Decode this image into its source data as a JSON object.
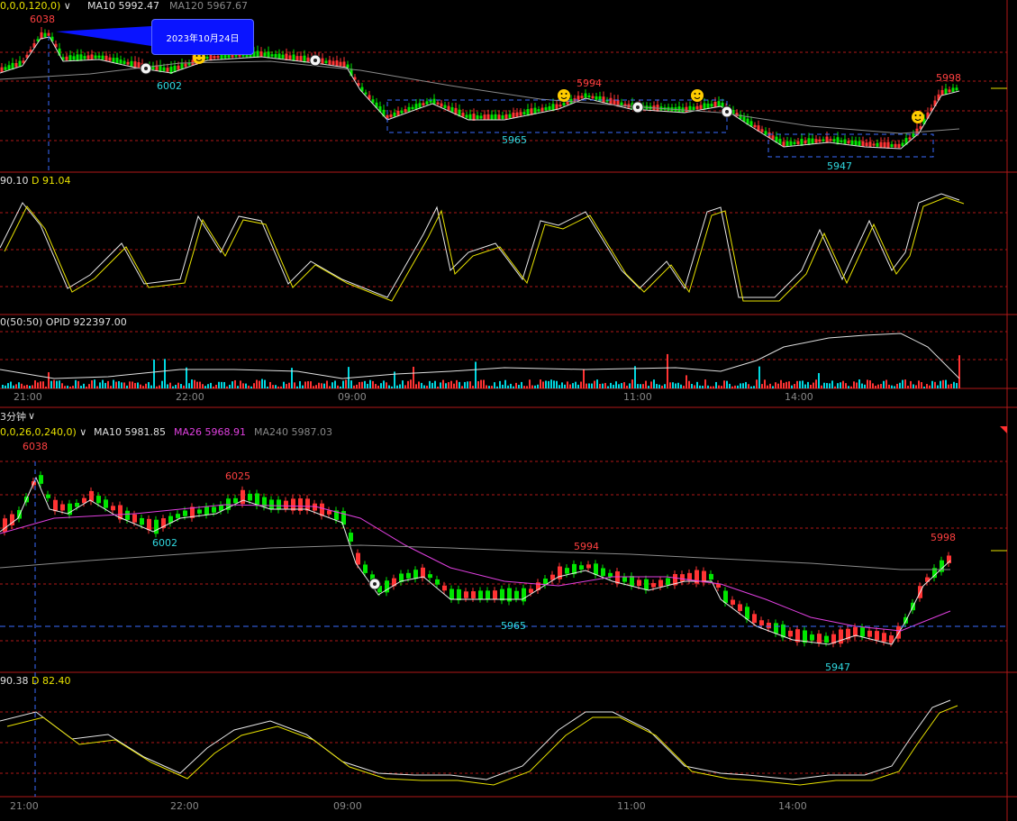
{
  "colors": {
    "up": "#ff3333",
    "down": "#00e600",
    "grid": "#b01818",
    "cyan": "#00d7e0",
    "yellow": "#e8e200",
    "magenta": "#e040e0",
    "gray": "#888888",
    "dashblue": "#3a6cff"
  },
  "top_panel": {
    "legend_params": "0,0,0,120,0)",
    "ma10": "MA10 5992.47",
    "ma120": "MA120 5967.67",
    "tooltip": "2023年10月24日",
    "price_labels": {
      "high_left": "6038",
      "low_left": "6002",
      "mid_high": "5994",
      "mid_low": "5965",
      "right_high": "5998",
      "right_low": "5947"
    }
  },
  "kd_panel_top": {
    "k_label": "90.10",
    "d_label": "D 91.04"
  },
  "volume_panel": {
    "params": "0(50:50)",
    "opid": "OPID 922397.00"
  },
  "time_axis_top": {
    "labels": [
      "21:00",
      "22:00",
      "09:00",
      "11:00",
      "14:00"
    ]
  },
  "timeframe": {
    "label": "3分钟"
  },
  "bottom_panel": {
    "legend_params": "0,0,26,0,240,0)",
    "ma10": "MA10 5981.85",
    "ma26": "MA26 5968.91",
    "ma240": "MA240 5987.03",
    "price_labels": {
      "high_left": "6038",
      "second_high": "6025",
      "low_left": "6002",
      "mid_high": "5994",
      "mid_low": "5965",
      "right_high": "5998",
      "right_low": "5947"
    }
  },
  "kd_panel_bottom": {
    "k_label": "90.38",
    "d_label": "D 82.40"
  },
  "time_axis_bottom": {
    "labels": [
      "21:00",
      "22:00",
      "09:00",
      "11:00",
      "14:00"
    ]
  }
}
